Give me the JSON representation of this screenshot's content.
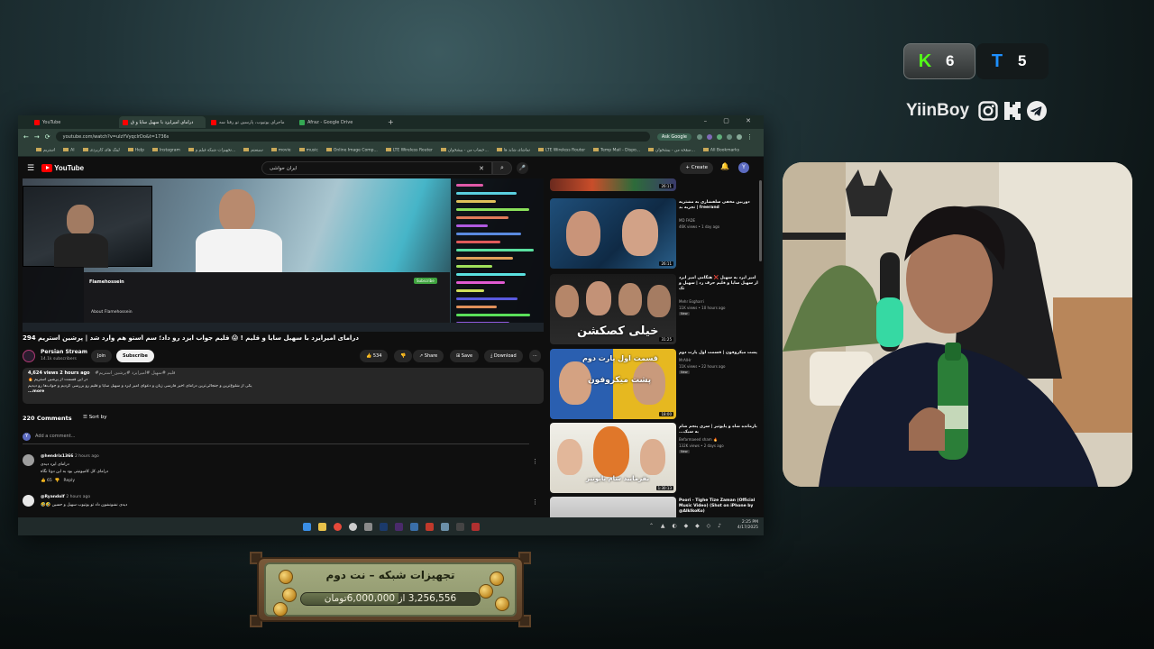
{
  "browser": {
    "tabs": [
      {
        "label": "YouTube",
        "active": false,
        "fav_color": "#ff0000"
      },
      {
        "label": "درامای امیرایزد با سهیل سایا و ق",
        "active": true,
        "fav_color": "#ff0000"
      },
      {
        "label": "ماجرای یوتیوب، پارسین تو رفتا سه",
        "active": false,
        "fav_color": "#ff0000"
      },
      {
        "label": "Afraz - Google Drive",
        "active": false,
        "fav_color": "#34a853"
      }
    ],
    "url": "youtube.com/watch?v=uIzYVyqcIrDo&t=1736s",
    "ask_google": "Ask Google",
    "bookmarks": [
      "استریم",
      "AI",
      "لینک های کاربردی",
      "Help",
      "Instagram",
      "تجهیزات شبکه فیلم و...",
      "سیستم",
      "movie",
      "music",
      "Online Image Comp...",
      "LTE Wireless Router",
      "حساب من - پیشخوان...",
      "تماشای شاید ها",
      "LTE Wireless Router",
      "Temp Mail - Dispo...",
      "صفحه من - پیشخوان...",
      "All Bookmarks"
    ]
  },
  "youtube": {
    "search_query": "ایران حواشی",
    "create_label": "Create",
    "avatar_letter": "Y",
    "video": {
      "title": "درامای امیرایزد با سهیل سایا و قلیم ! 😱 قلیم جواب ایزد رو داد؛ سم استو هم وارد شد | پرشین استریم 294",
      "inner_streamer": "Flamehossein",
      "inner_about": "About Flamehossein",
      "inner_follow": "Subscribe"
    },
    "channel": {
      "name": "Persian Stream",
      "subs": "14.1k subscribers",
      "join": "Join",
      "subscribe": "Subscribe"
    },
    "actions": {
      "likes": "534",
      "share": "Share",
      "save": "Save",
      "download": "Download"
    },
    "description": {
      "meta": "4,624 views  2 hours ago",
      "hashtags": "#قلیم #سهیل #امیرایزد #پرشین_استریم",
      "line1": "در این قسمت از پرشین استریم 🔥",
      "line2": "یکی از شلوغ‌ترین و جنجالی‌ترین درامای اخیر فارسی زبان و دعوای امیر ایزد و سهیل سایا و قلیم رو بررسی کردیم و جواب‌ها رو دیدیم",
      "more": "...more"
    },
    "comments": {
      "count_label": "220 Comments",
      "sort_label": "Sort by",
      "add_placeholder": "Add a comment...",
      "items": [
        {
          "user": "@hendrix1366",
          "time": "2 hours ago",
          "line1": "درامای ایزد دیدی",
          "line2": "درامای کل کامیونیتی بود به این دوتا نگاه",
          "likes": "65",
          "reply": "Reply"
        },
        {
          "user": "@Ryandolf",
          "time": "2 hours ago",
          "line1": "دیدی نشونشون داد تو یوتیوب سهیل و حسین 🤣🤣",
          "line2": "",
          "likes": "",
          "reply": ""
        }
      ]
    },
    "recommendations": [
      {
        "title": "دوربین مخفی سلفشاری به مشتریه freerand | تجربه بد",
        "channel": "MD FADE",
        "stats": "46K views • 1 day ago",
        "duration": "26:11",
        "badge": ""
      },
      {
        "title": "امیر ایزد به سهیل ❌ هنگامی امیر ایزد از سهیل سایا و قلیم حرف زد | سهیل و تک",
        "channel": "Mehr Esgharri",
        "stats": "11K views • 10 hours ago",
        "duration": "31:25",
        "badge": "New",
        "thumb_text": "خیلی کصکشن"
      },
      {
        "title": "پشت میکروفون | قسمت اول پارت دوم",
        "channel": "MrAlHr",
        "stats": "11K views • 22 hours ago",
        "duration": "18:00",
        "badge": "New",
        "thumb_text1": "قسمت اول پارت دوم",
        "thumb_text2": "پشت میکروفون"
      },
      {
        "title": "بازمانده شاه و پاپوتیر | سری پنجم شام به سبک...",
        "channel": "Befarmaeed sham 🔥",
        "stats": "132K views • 2 days ago",
        "duration": "1:30:13",
        "badge": "New",
        "thumb_text": "بفرمایید شام پاپوتیر"
      },
      {
        "title": "Poori - Tighe Tize Zaman (Official Music Video) (Shot on iPhone by @AlkIkoKo)",
        "channel": "",
        "stats": "",
        "duration": "",
        "badge": ""
      }
    ]
  },
  "taskbar": {
    "time": "2:25 PM",
    "date": "4/17/2025"
  },
  "overlay": {
    "kick_count": "6",
    "telegram_count": "5",
    "brand": "YiinBoy",
    "goal_title": "تجهیزات شبکه – نت دوم",
    "goal_current": "3,256,556",
    "goal_sep": "از",
    "goal_target": "6,000,000",
    "goal_currency": "تومان",
    "goal_progress": 0.543,
    "colors": {
      "kick": "#53fc18",
      "telegram": "#1e90ff",
      "youtube_red": "#ff0000"
    }
  }
}
